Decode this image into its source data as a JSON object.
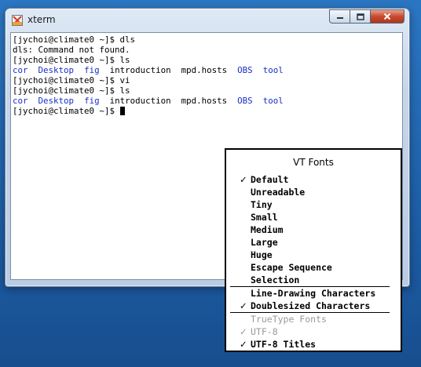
{
  "window": {
    "title": "xterm",
    "colors": {
      "dir_blue": "#1a2ec7",
      "close_red": "#c84a2f"
    }
  },
  "terminal": {
    "lines": [
      {
        "type": "text",
        "text": "[jychoi@climate0 ~]$ dls"
      },
      {
        "type": "text",
        "text": "dls: Command not found."
      },
      {
        "type": "text",
        "text": "[jychoi@climate0 ~]$ ls"
      },
      {
        "type": "ls",
        "entries": [
          {
            "name": "cor",
            "dir": true
          },
          {
            "name": "Desktop",
            "dir": true
          },
          {
            "name": "fig",
            "dir": true
          },
          {
            "name": "introduction",
            "dir": false
          },
          {
            "name": "mpd.hosts",
            "dir": false
          },
          {
            "name": "OBS",
            "dir": true
          },
          {
            "name": "tool",
            "dir": true
          }
        ]
      },
      {
        "type": "text",
        "text": "[jychoi@climate0 ~]$ vi"
      },
      {
        "type": "text",
        "text": "[jychoi@climate0 ~]$ ls"
      },
      {
        "type": "ls",
        "entries": [
          {
            "name": "cor",
            "dir": true
          },
          {
            "name": "Desktop",
            "dir": true
          },
          {
            "name": "fig",
            "dir": true
          },
          {
            "name": "introduction",
            "dir": false
          },
          {
            "name": "mpd.hosts",
            "dir": false
          },
          {
            "name": "OBS",
            "dir": true
          },
          {
            "name": "tool",
            "dir": true
          }
        ]
      },
      {
        "type": "prompt",
        "text": "[jychoi@climate0 ~]$ "
      }
    ]
  },
  "vt_fonts_menu": {
    "title": "VT Fonts",
    "items": [
      {
        "label": "Default",
        "checked": true,
        "enabled": true
      },
      {
        "label": "Unreadable",
        "checked": false,
        "enabled": true
      },
      {
        "label": "Tiny",
        "checked": false,
        "enabled": true
      },
      {
        "label": "Small",
        "checked": false,
        "enabled": true
      },
      {
        "label": "Medium",
        "checked": false,
        "enabled": true
      },
      {
        "label": "Large",
        "checked": false,
        "enabled": true
      },
      {
        "label": "Huge",
        "checked": false,
        "enabled": true
      },
      {
        "label": "Escape Sequence",
        "checked": false,
        "enabled": true
      },
      {
        "label": "Selection",
        "checked": false,
        "enabled": true
      },
      {
        "separator": true
      },
      {
        "label": "Line-Drawing Characters",
        "checked": false,
        "enabled": true
      },
      {
        "label": "Doublesized Characters",
        "checked": true,
        "enabled": true
      },
      {
        "separator": true
      },
      {
        "label": "TrueType Fonts",
        "checked": false,
        "enabled": false
      },
      {
        "label": "UTF-8",
        "checked": true,
        "enabled": false
      },
      {
        "label": "UTF-8 Titles",
        "checked": true,
        "enabled": true
      }
    ]
  }
}
